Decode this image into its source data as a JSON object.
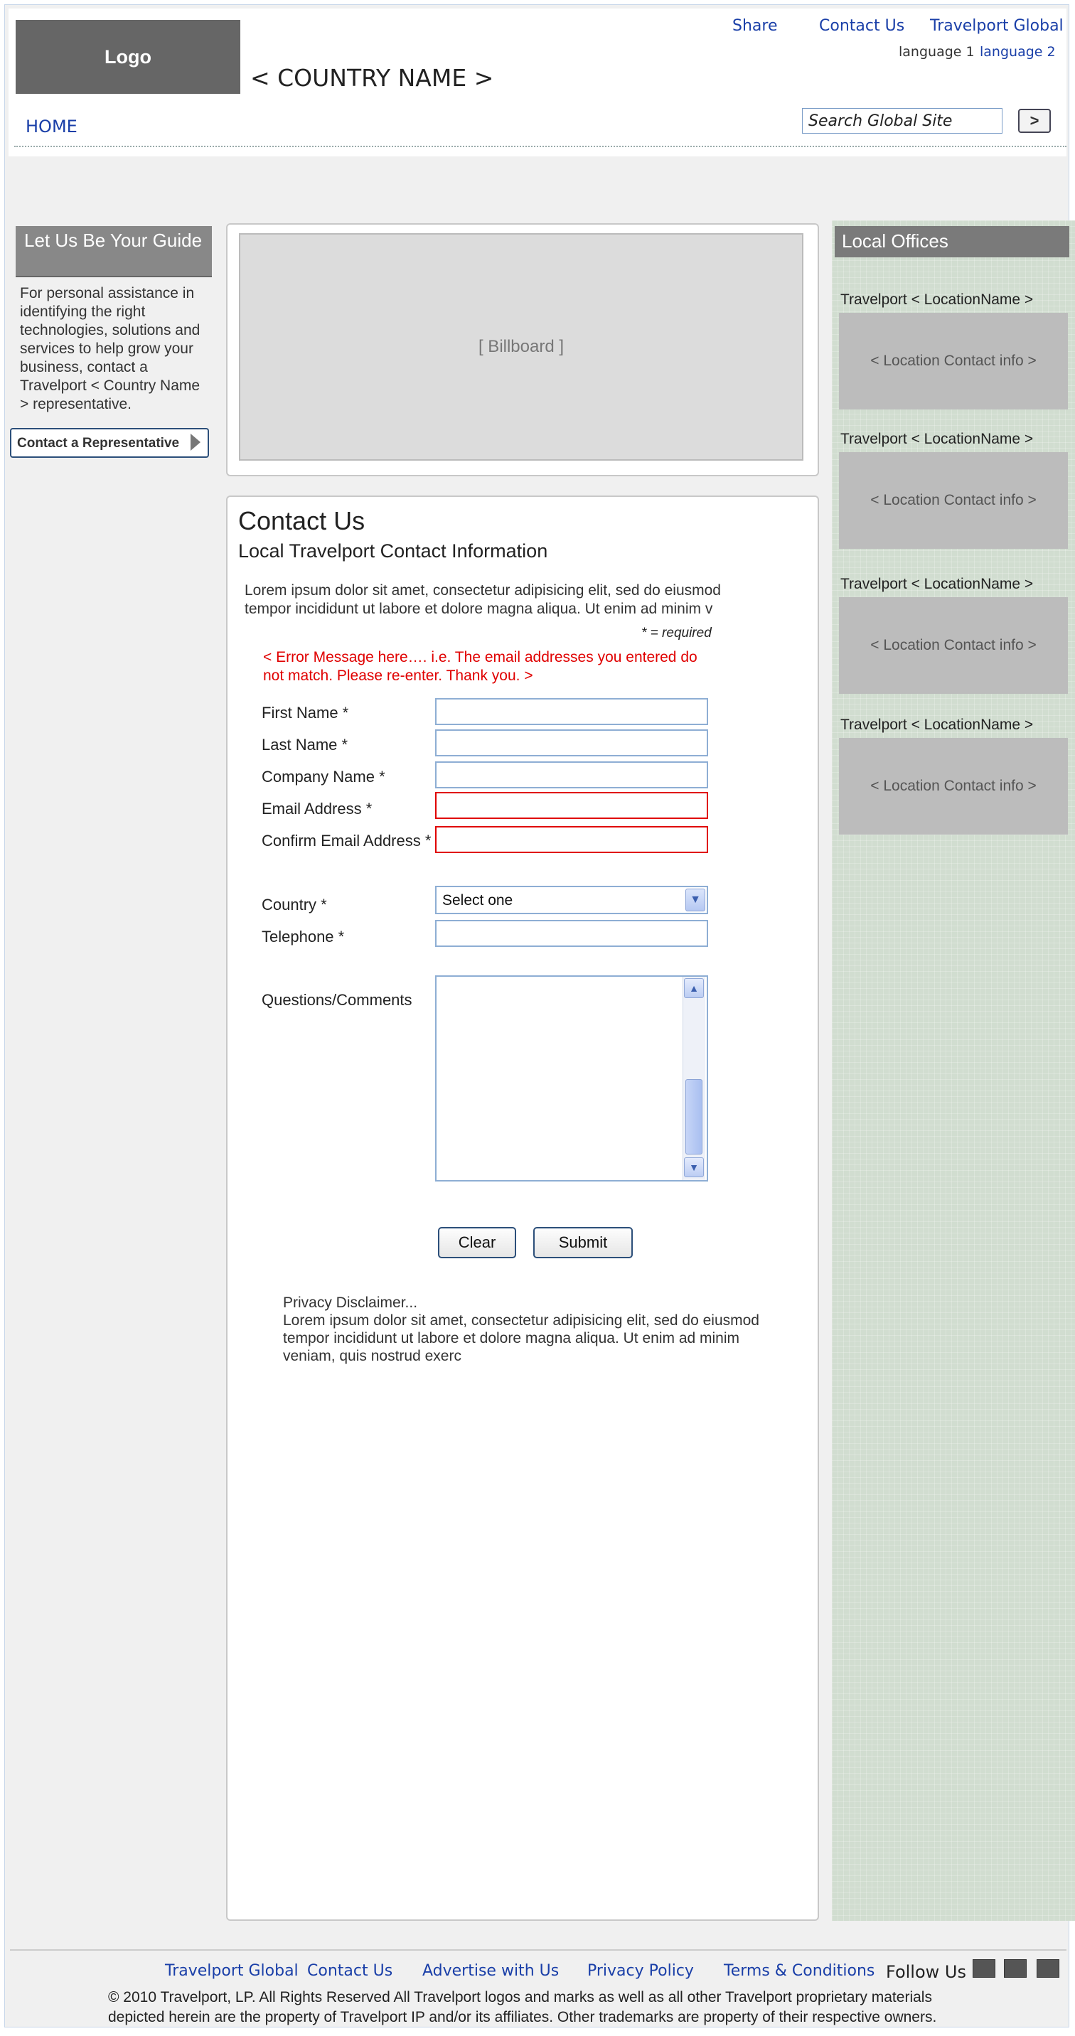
{
  "header": {
    "logo": "Logo",
    "country_name": "< COUNTRY NAME >",
    "links": [
      "Share",
      "Contact Us",
      "Travelport Global"
    ],
    "language_1": "language 1",
    "language_2": "language 2",
    "home": "HOME",
    "search_placeholder": "Search Global Site",
    "search_go": ">"
  },
  "guide": {
    "title": "Let Us Be Your Guide",
    "text": "For personal assistance in identifying the right technologies, solutions and services to help grow your business, contact a Travelport < Country Name > representative.",
    "button": "Contact a Representative"
  },
  "billboard": "[ Billboard ]",
  "main": {
    "title": "Contact Us",
    "subtitle": "Local Travelport Contact Information",
    "intro": "Lorem ipsum dolor sit amet, consectetur adipisicing elit, sed do eiusmod tempor incididunt ut labore et dolore magna aliqua. Ut enim ad minim v",
    "required_note": "* = required",
    "error": "< Error Message here…. i.e. The email addresses you entered do not match. Please re-enter. Thank you. >",
    "fields": {
      "first_name": "First Name *",
      "last_name": "Last Name *",
      "company": "Company Name *",
      "email": "Email Address *",
      "confirm_email": "Confirm Email Address *",
      "country": "Country *",
      "country_value": "Select one",
      "telephone": "Telephone *",
      "comments": "Questions/Comments"
    },
    "clear": "Clear",
    "submit": "Submit",
    "disclaimer_title": "Privacy Disclaimer...",
    "disclaimer_text": "Lorem ipsum dolor sit amet, consectetur adipisicing elit, sed do eiusmod tempor incididunt ut labore et dolore magna aliqua. Ut enim ad minim veniam, quis nostrud exerc"
  },
  "offices": {
    "title": "Local Offices",
    "items": [
      {
        "name": "Travelport < LocationName >",
        "info": "< Location Contact info >"
      },
      {
        "name": "Travelport < LocationName >",
        "info": "< Location Contact info >"
      },
      {
        "name": "Travelport < LocationName >",
        "info": "< Location Contact info >"
      },
      {
        "name": "Travelport < LocationName >",
        "info": "< Location Contact info >"
      }
    ]
  },
  "footer": {
    "links": [
      "Travelport Global",
      "Contact Us",
      "Advertise with Us",
      "Privacy Policy",
      "Terms & Conditions"
    ],
    "follow": "Follow Us",
    "social_icons": [
      "social-icon-1",
      "social-icon-2",
      "social-icon-3"
    ],
    "copyright": "© 2010 Travelport, LP. All Rights Reserved All Travelport logos and marks as well as all other Travelport proprietary materials depicted herein are the property of Travelport IP and/or its affiliates. Other trademarks are property of their respective owners."
  }
}
